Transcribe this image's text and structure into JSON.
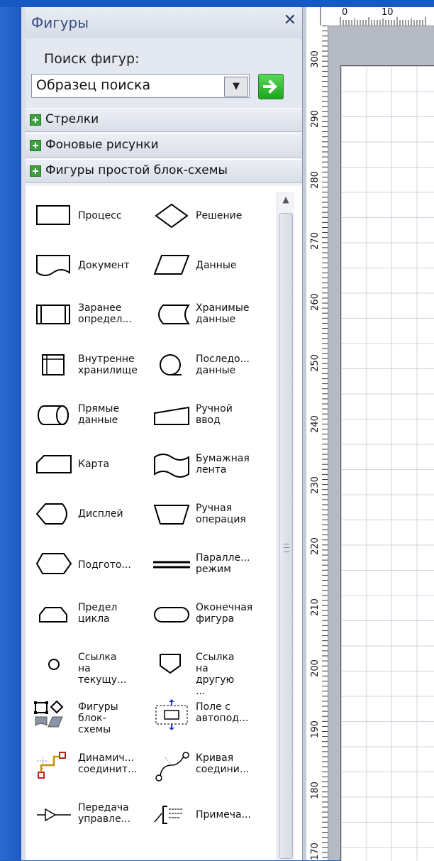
{
  "panel": {
    "title": "Фигуры",
    "close_icon": "close-icon",
    "search_label": "Поиск фигур:",
    "search_value": "Образец поиска"
  },
  "stencils": [
    {
      "label": "Стрелки"
    },
    {
      "label": "Фоновые рисунки"
    },
    {
      "label": "Фигуры простой блок-схемы"
    }
  ],
  "shapes": [
    {
      "label": "Процесс",
      "icon": "process-shape-icon"
    },
    {
      "label": "Решение",
      "icon": "decision-shape-icon"
    },
    {
      "label": "Документ",
      "icon": "document-shape-icon"
    },
    {
      "label": "Данные",
      "icon": "data-shape-icon"
    },
    {
      "label": "Заранее определ...",
      "icon": "predefined-process-icon"
    },
    {
      "label": "Хранимые данные",
      "icon": "stored-data-icon"
    },
    {
      "label": "Внутренне хранилище",
      "icon": "internal-storage-icon"
    },
    {
      "label": "Последо... данные",
      "icon": "sequential-data-icon"
    },
    {
      "label": "Прямые данные",
      "icon": "direct-data-icon"
    },
    {
      "label": "Ручной ввод",
      "icon": "manual-input-icon"
    },
    {
      "label": "Карта",
      "icon": "card-shape-icon"
    },
    {
      "label": "Бумажная лента",
      "icon": "paper-tape-icon"
    },
    {
      "label": "Дисплей",
      "icon": "display-shape-icon"
    },
    {
      "label": "Ручная операция",
      "icon": "manual-operation-icon"
    },
    {
      "label": "Подгото...",
      "icon": "preparation-shape-icon"
    },
    {
      "label": "Паралле... режим",
      "icon": "parallel-mode-icon"
    },
    {
      "label": "Предел цикла",
      "icon": "loop-limit-icon"
    },
    {
      "label": "Оконечная фигура",
      "icon": "terminator-shape-icon"
    },
    {
      "label": "Ссылка на текущу...",
      "icon": "on-page-reference-icon"
    },
    {
      "label": "Ссылка на другую ...",
      "icon": "off-page-reference-icon"
    },
    {
      "label": "Фигуры блок-схемы",
      "icon": "flowchart-shapes-icon"
    },
    {
      "label": "Поле с автопод...",
      "icon": "auto-height-box-icon"
    },
    {
      "label": "Динамич... соединит...",
      "icon": "dynamic-connector-icon"
    },
    {
      "label": "Кривая соедини...",
      "icon": "curved-connector-icon"
    },
    {
      "label": "Передача управле...",
      "icon": "control-transfer-icon"
    },
    {
      "label": "Примеча...",
      "icon": "annotation-icon"
    }
  ],
  "ruler_top": [
    "0",
    "10"
  ],
  "ruler_left": [
    "300",
    "290",
    "280",
    "270",
    "260",
    "250",
    "240",
    "230",
    "220",
    "210",
    "200",
    "190",
    "180",
    "170"
  ]
}
